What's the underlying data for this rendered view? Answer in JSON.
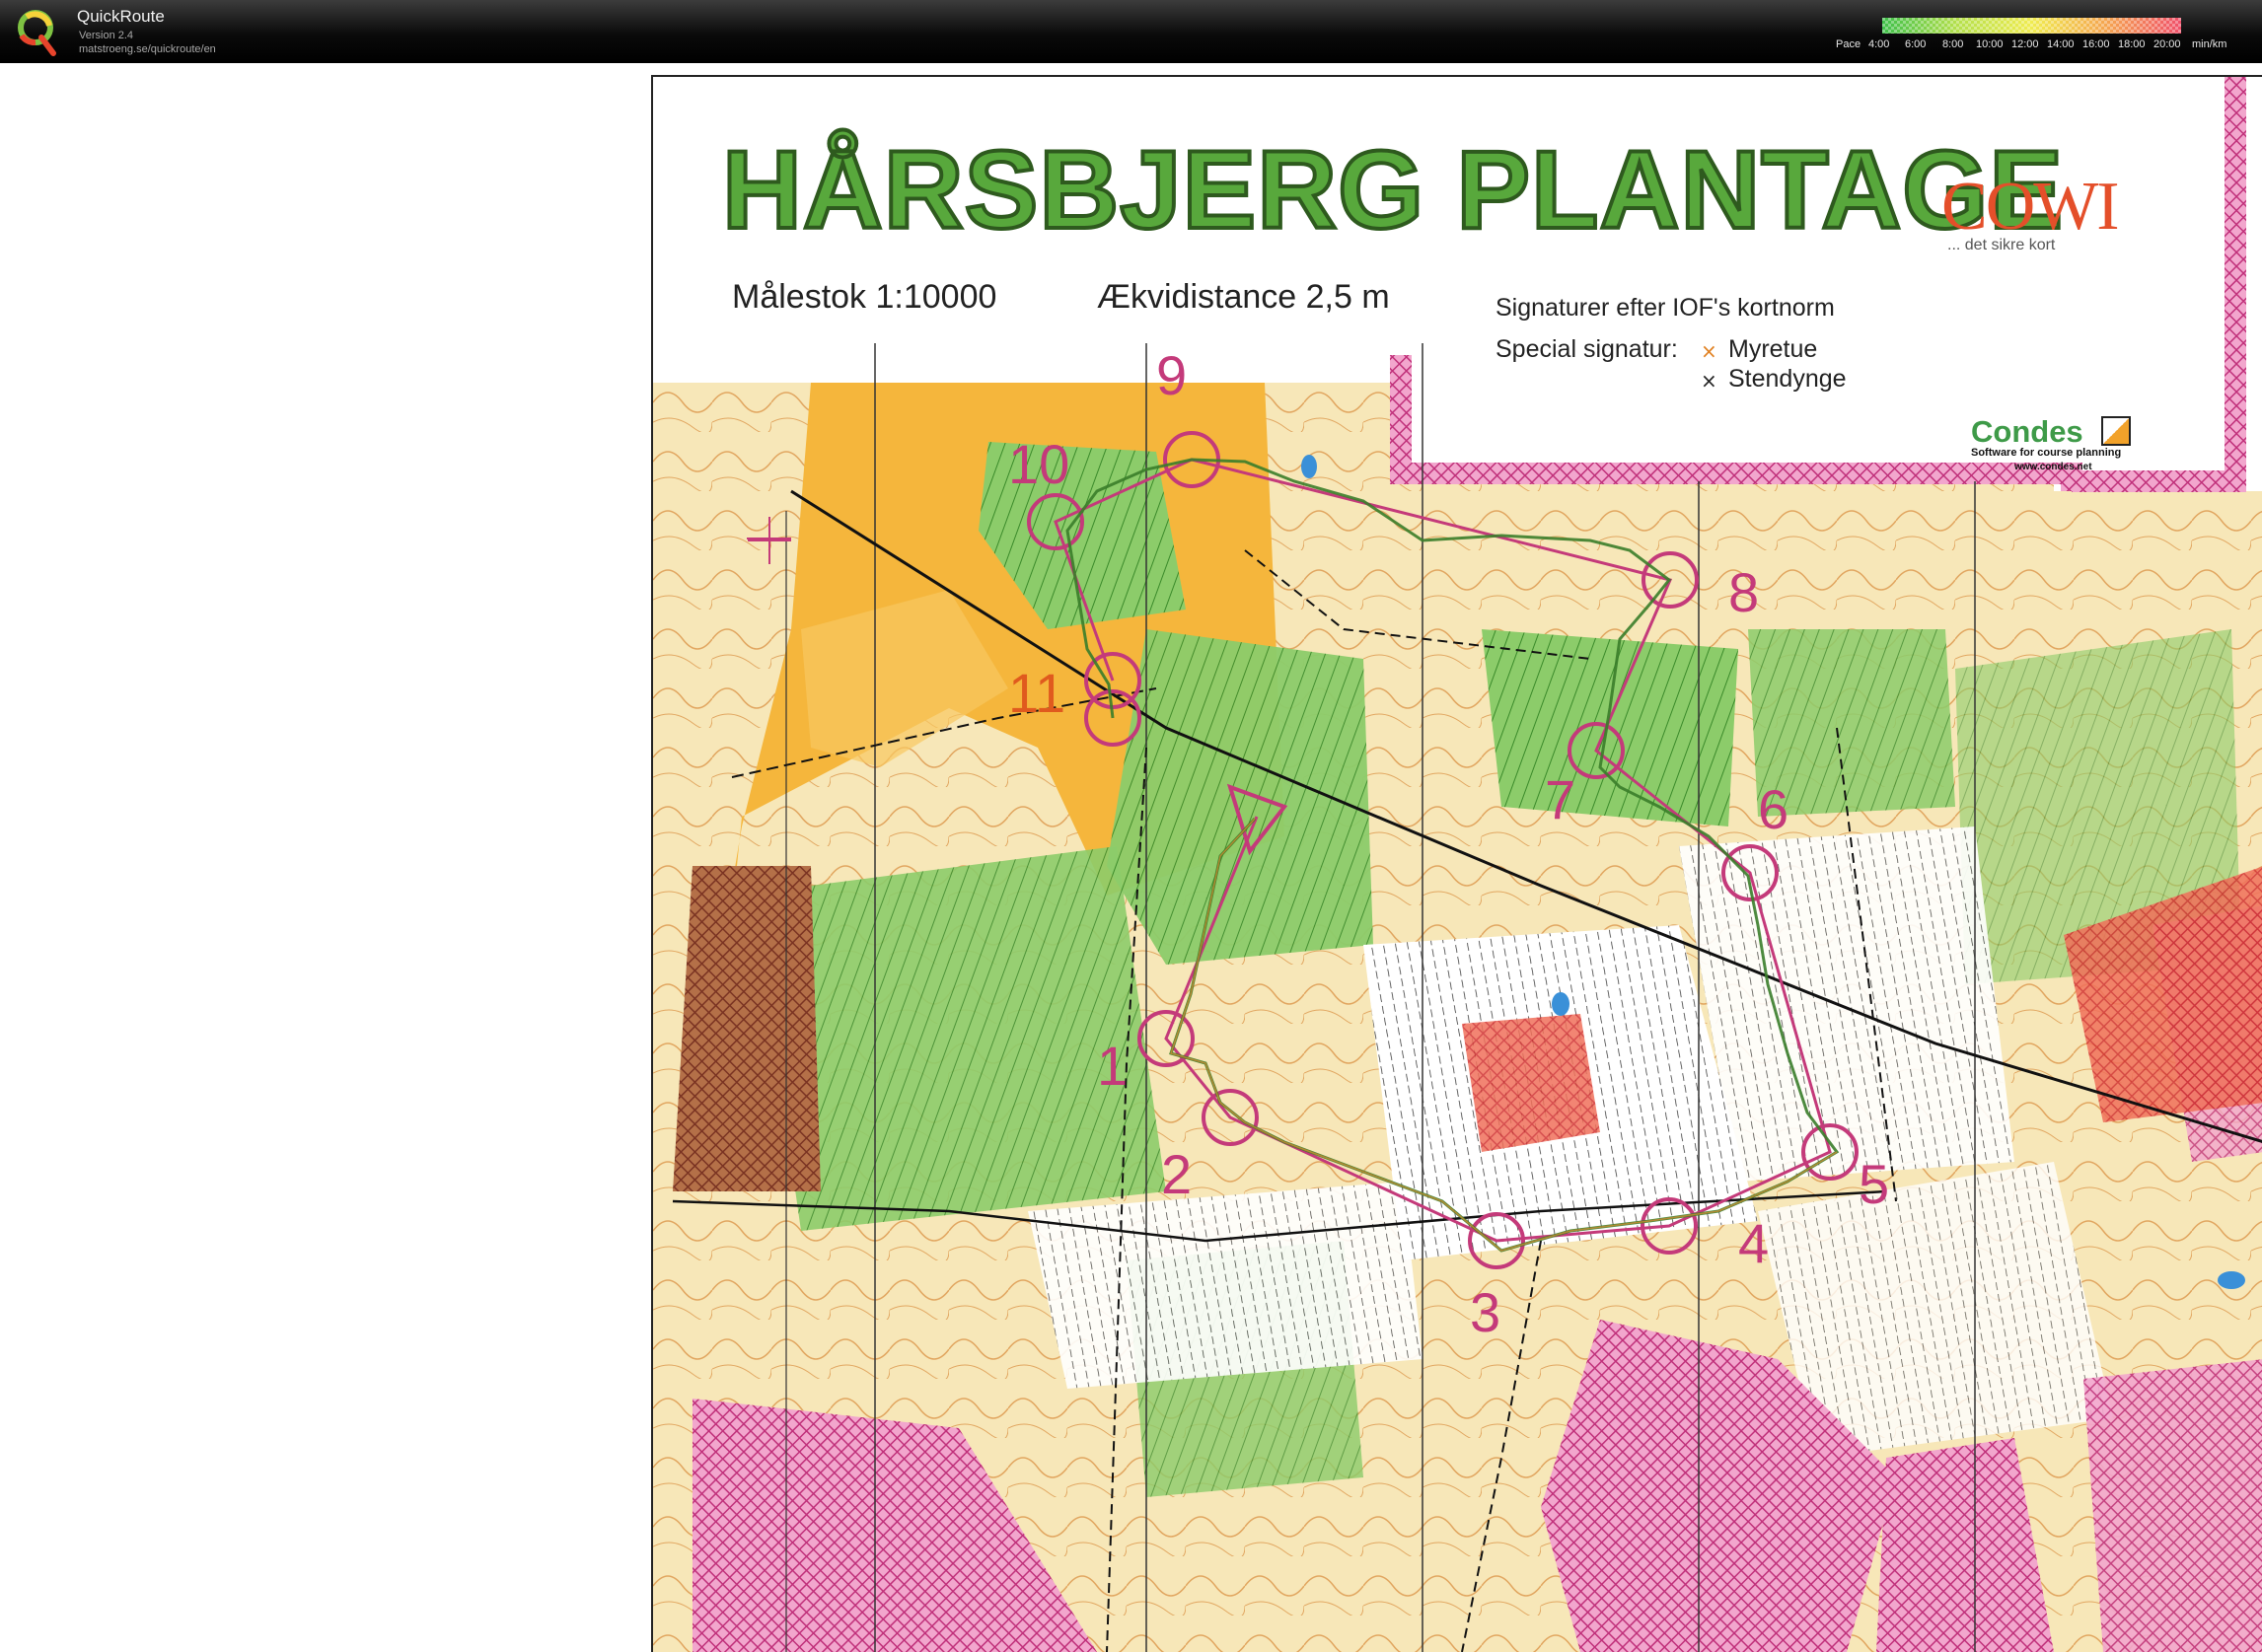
{
  "app": {
    "title": "QuickRoute",
    "version": "Version 2.4",
    "url": "matstroeng.se/quickroute/en"
  },
  "pace_scale": {
    "label": "Pace",
    "ticks": [
      "4:00",
      "6:00",
      "8:00",
      "10:00",
      "12:00",
      "14:00",
      "16:00",
      "18:00",
      "20:00"
    ],
    "unit": "min/km",
    "gradient": [
      "#3ec04a",
      "#b4e04c",
      "#f0ec50",
      "#f5a550",
      "#f0506a"
    ]
  },
  "map": {
    "title": "HÅRSBJERG PLANTAGE",
    "scale": "Målestok 1:10000",
    "contour": "Ækvidistance 2,5 m",
    "legend": {
      "line1": "Signaturer efter IOF's kortnorm",
      "line2": "Special signatur:",
      "symbol1": "Myretue",
      "symbol2": "Stendynge"
    },
    "sponsor": {
      "name": "COWI",
      "tagline": "... det sikre kort"
    },
    "software": {
      "name": "Condes",
      "tagline": "Software for course planning",
      "url": "www.condes.net"
    },
    "controls": [
      "1",
      "2",
      "3",
      "4",
      "5",
      "6",
      "7",
      "8",
      "9",
      "10",
      "11"
    ],
    "colors": {
      "course": "#c43a7a",
      "route": "#3a7d2a",
      "forest": "#63b14a",
      "open": "#f5b63c",
      "forbidden": "#c0307a"
    }
  }
}
